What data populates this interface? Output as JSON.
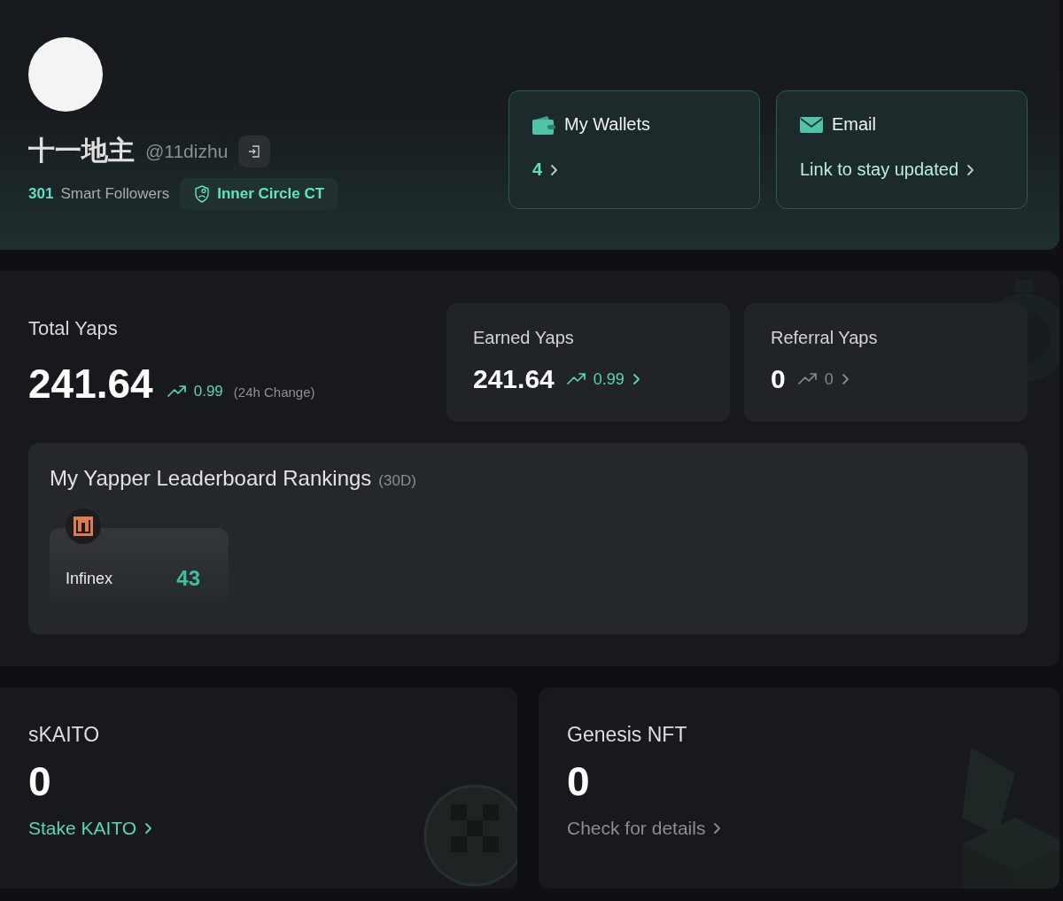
{
  "profile": {
    "name": "十一地主",
    "handle": "@11dizhu",
    "followers_count": "301",
    "followers_label": "Smart Followers",
    "badge": "Inner Circle CT"
  },
  "account_cards": [
    {
      "kind": "wallets",
      "title": "My Wallets",
      "value": "4"
    },
    {
      "kind": "email",
      "title": "Email",
      "value": "Link to stay updated"
    }
  ],
  "total_yaps": {
    "label": "Total Yaps",
    "value": "241.64",
    "change": "0.99",
    "change_note": "(24h Change)"
  },
  "yap_cards": [
    {
      "label": "Earned Yaps",
      "value": "241.64",
      "change": "0.99",
      "positive": true
    },
    {
      "label": "Referral Yaps",
      "value": "0",
      "change": "0",
      "positive": false
    }
  ],
  "leaderboard": {
    "title": "My Yapper Leaderboard Rankings",
    "period": "(30D)",
    "items": [
      {
        "name": "Infinex",
        "rank": "43"
      }
    ]
  },
  "holdings": [
    {
      "kind": "coin",
      "title": "sKAITO",
      "value": "0",
      "link": "Stake KAITO",
      "highlighted": true
    },
    {
      "kind": "box",
      "title": "Genesis NFT",
      "value": "0",
      "link": "Check for details",
      "highlighted": false
    }
  ]
}
